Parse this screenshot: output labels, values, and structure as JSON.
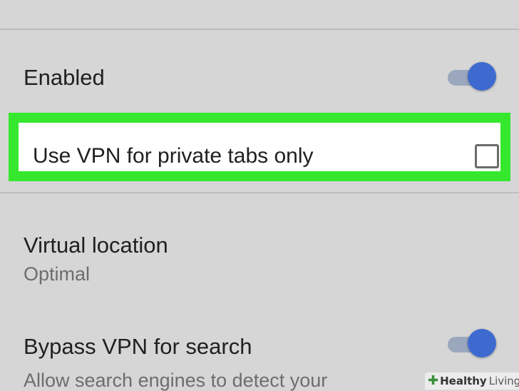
{
  "settings": {
    "enabled": {
      "label": "Enabled",
      "state": "on"
    },
    "private_tabs_only": {
      "label": "Use VPN for private tabs only",
      "checked": false
    },
    "virtual_location": {
      "label": "Virtual location",
      "value": "Optimal"
    },
    "bypass_search": {
      "label": "Bypass VPN for search",
      "description": "Allow search engines to detect your",
      "state": "on"
    }
  },
  "colors": {
    "background": "#d6d6d6",
    "highlight": "#35e82d",
    "toggle_thumb": "#3e6ad0",
    "toggle_track": "#9aa7bd"
  },
  "icons": {
    "toggle": "toggle-switch-icon",
    "checkbox": "checkbox-icon",
    "watermark": "medical-cross-icon"
  },
  "watermark": {
    "word1": "Healthy",
    "word2": "Living"
  }
}
